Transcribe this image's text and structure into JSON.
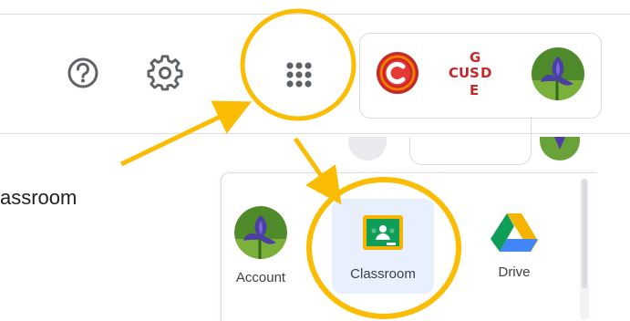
{
  "partial_text": "assroom",
  "header": {
    "help_icon": "help-circle-icon",
    "settings_icon": "gear-icon",
    "apps_icon": "apps-grid-icon",
    "cusd_logo_letters": "CUSD GE"
  },
  "apps": [
    {
      "label": "Account",
      "icon": "account-avatar-icon"
    },
    {
      "label": "Classroom",
      "icon": "classroom-icon"
    },
    {
      "label": "Drive",
      "icon": "drive-icon"
    }
  ],
  "colors": {
    "highlight": "#FBBC04",
    "classroom_green": "#0F9D58",
    "drive_blue": "#4285F4",
    "drive_green": "#0F9D58",
    "drive_yellow": "#F4B400",
    "classroom_tile_bg": "#E8F0FE"
  }
}
